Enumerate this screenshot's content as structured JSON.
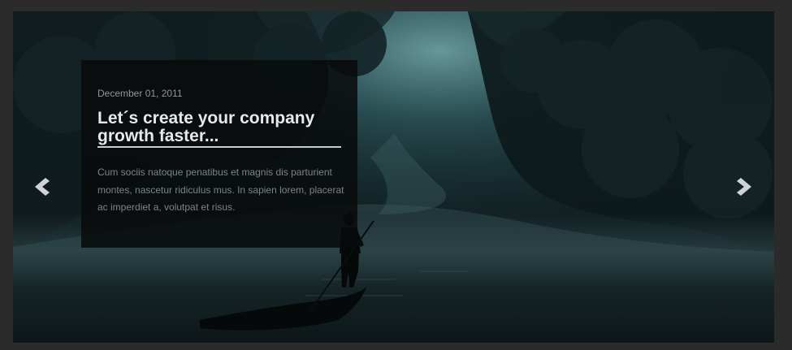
{
  "slide": {
    "date": "December 01, 2011",
    "title": "Let´s create your company growth faster...",
    "text": "Cum sociis natoque penatibus et magnis dis parturient montes, nascetur ridiculus mus. In sapien lorem, placerat ac imperdiet a, volutpat et risus.",
    "image": "misty-river-boatman"
  },
  "controls": {
    "prev_icon": "chevron-left-icon",
    "next_icon": "chevron-right-icon"
  },
  "colors": {
    "frame": "#2b2b2b",
    "caption_bg": "#080a0b",
    "title": "#e6e8e9",
    "date": "#8e9699",
    "text": "#7c8487",
    "arrow": "#cfd3d5"
  }
}
